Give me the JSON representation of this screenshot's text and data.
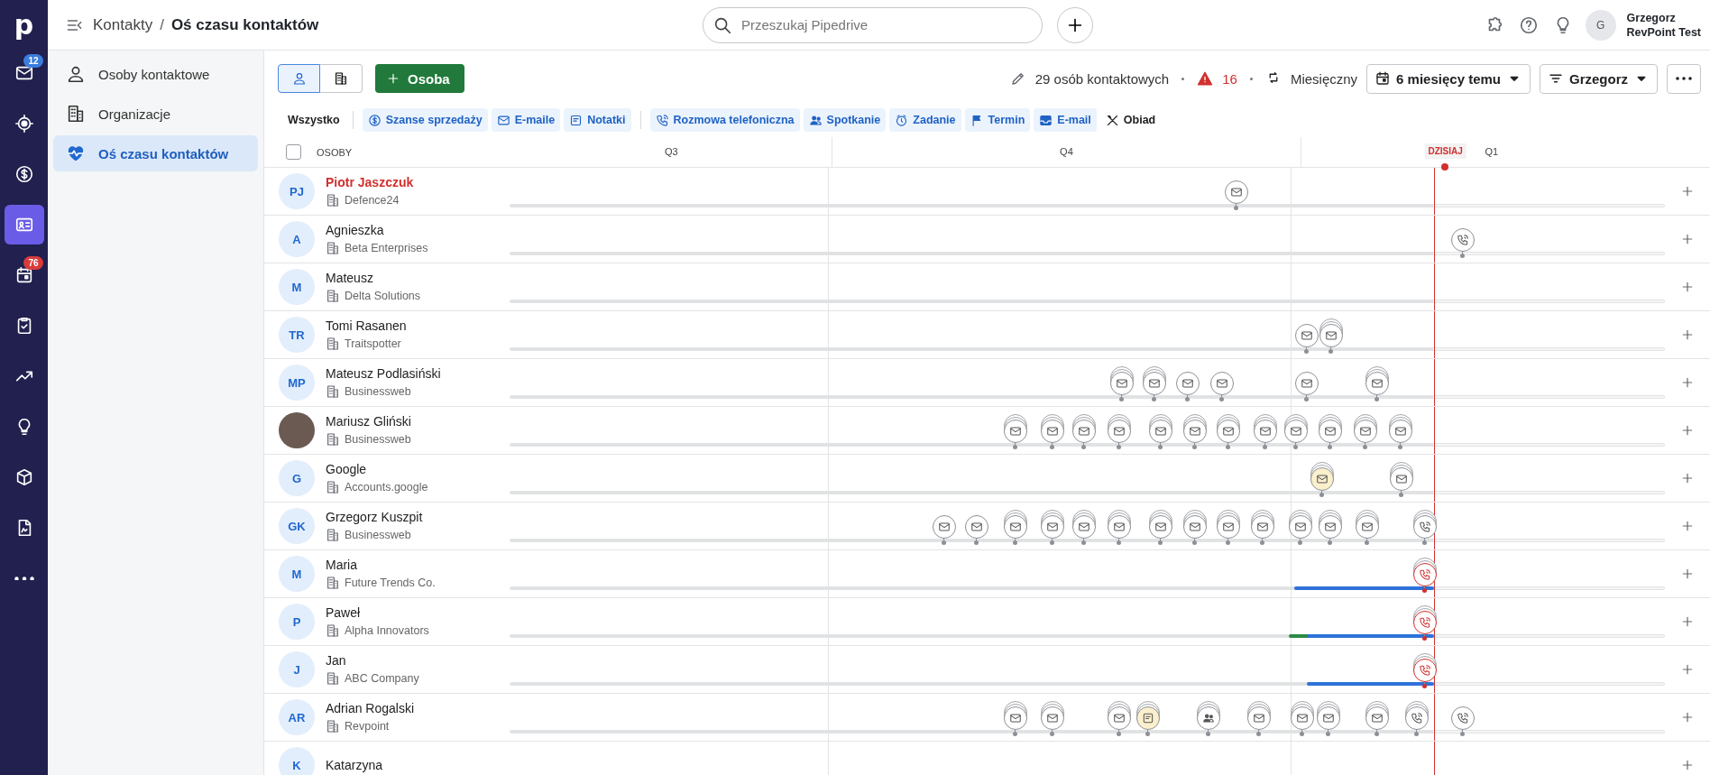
{
  "logo": "p",
  "rail": [
    {
      "kind": "mail",
      "badge": "12",
      "color": "#3b7ddd",
      "selected": false
    },
    {
      "kind": "target",
      "selected": false
    },
    {
      "kind": "deals",
      "selected": false
    },
    {
      "kind": "contacts",
      "selected": true
    },
    {
      "kind": "calendar",
      "badge": "76",
      "color": "#d93b3b",
      "selected": false
    },
    {
      "kind": "tasks",
      "selected": false
    },
    {
      "kind": "insights",
      "selected": false
    },
    {
      "kind": "campaigns",
      "selected": false
    },
    {
      "kind": "products",
      "selected": false
    },
    {
      "kind": "documents",
      "selected": false
    },
    {
      "kind": "more",
      "selected": false
    }
  ],
  "breadcrumb": {
    "parent": "Kontakty",
    "separator": "/",
    "current": "Oś czasu kontaktów"
  },
  "search": {
    "placeholder": "Przeszukaj Pipedrive"
  },
  "user": {
    "initial": "G",
    "name": "Grzegorz",
    "company": "RevPoint Test"
  },
  "sidebar": [
    {
      "kind": "person",
      "label": "Osoby kontaktowe",
      "selected": false
    },
    {
      "kind": "org",
      "label": "Organizacje",
      "selected": false
    },
    {
      "kind": "timeline",
      "label": "Oś czasu kontaktów",
      "selected": true
    }
  ],
  "view_toggle": [
    {
      "kind": "person",
      "selected": true
    },
    {
      "kind": "org",
      "selected": false
    }
  ],
  "add_button": {
    "label": "Osoba"
  },
  "summary": {
    "count": "29 osób kontaktowych",
    "alerts": "16",
    "interval": "Miesięczny"
  },
  "period_dropdown": {
    "label": "6 miesięcy temu"
  },
  "owner_filter": {
    "label": "Grzegorz"
  },
  "filters": [
    {
      "kind": "all",
      "label": "Wszystko",
      "selected": false
    },
    {
      "kind": "deal",
      "label": "Szanse sprzedaży",
      "selected": true
    },
    {
      "kind": "email",
      "label": "E-maile",
      "selected": true
    },
    {
      "kind": "note",
      "label": "Notatki",
      "selected": true
    },
    {
      "kind": "call",
      "label": "Rozmowa telefoniczna",
      "selected": true
    },
    {
      "kind": "meeting",
      "label": "Spotkanie",
      "selected": true
    },
    {
      "kind": "task",
      "label": "Zadanie",
      "selected": true
    },
    {
      "kind": "deadline",
      "label": "Termin",
      "selected": true
    },
    {
      "kind": "inbox",
      "label": "E-mail",
      "selected": true
    },
    {
      "kind": "lunch",
      "label": "Obiad",
      "selected": false
    }
  ],
  "header": {
    "select_all": false,
    "column": "OSOBY",
    "quarters": [
      "Q3",
      "Q4",
      "Q1"
    ],
    "today": "DZISIAJ"
  },
  "rows": [
    {
      "initials": "PJ",
      "photo": false,
      "name": "Piotr Jaszczuk",
      "name_alert": true,
      "company": "Defence24",
      "events": [
        {
          "kind": "email",
          "stacked": false,
          "highlighted": false,
          "overdue": false
        }
      ]
    },
    {
      "initials": "A",
      "photo": false,
      "name": "Agnieszka",
      "name_alert": false,
      "company": "Beta Enterprises",
      "events": [
        {
          "kind": "call",
          "stacked": false,
          "highlighted": false,
          "overdue": false
        }
      ]
    },
    {
      "initials": "M",
      "photo": false,
      "name": "Mateusz",
      "name_alert": false,
      "company": "Delta Solutions",
      "events": []
    },
    {
      "initials": "TR",
      "photo": false,
      "name": "Tomi Rasanen",
      "name_alert": false,
      "company": "Traitspotter",
      "events": [
        {
          "kind": "email",
          "stacked": false,
          "highlighted": false,
          "overdue": false
        },
        {
          "kind": "email",
          "stacked": true,
          "highlighted": false,
          "overdue": false
        }
      ]
    },
    {
      "initials": "MP",
      "photo": false,
      "name": "Mateusz Podlasiński",
      "name_alert": false,
      "company": "Businessweb",
      "events": [
        {
          "kind": "email",
          "stacked": true,
          "highlighted": false,
          "overdue": false
        },
        {
          "kind": "email",
          "stacked": true,
          "highlighted": false,
          "overdue": false
        },
        {
          "kind": "email",
          "stacked": false,
          "highlighted": false,
          "overdue": false
        },
        {
          "kind": "email",
          "stacked": false,
          "highlighted": false,
          "overdue": false
        },
        {
          "kind": "email",
          "stacked": false,
          "highlighted": false,
          "overdue": false
        },
        {
          "kind": "email",
          "stacked": true,
          "highlighted": false,
          "overdue": false
        }
      ]
    },
    {
      "photo": true,
      "name": "Mariusz Gliński",
      "name_alert": false,
      "company": "Businessweb",
      "events": [
        {
          "kind": "email",
          "stacked": true,
          "highlighted": false,
          "overdue": false
        },
        {
          "kind": "email",
          "stacked": true,
          "highlighted": false,
          "overdue": false
        },
        {
          "kind": "email",
          "stacked": true,
          "highlighted": false,
          "overdue": false
        },
        {
          "kind": "email",
          "stacked": true,
          "highlighted": false,
          "overdue": false
        },
        {
          "kind": "email",
          "stacked": true,
          "highlighted": false,
          "overdue": false
        },
        {
          "kind": "email",
          "stacked": true,
          "highlighted": false,
          "overdue": false
        },
        {
          "kind": "email",
          "stacked": true,
          "highlighted": false,
          "overdue": false
        },
        {
          "kind": "email",
          "stacked": true,
          "highlighted": false,
          "overdue": false
        },
        {
          "kind": "email",
          "stacked": true,
          "highlighted": false,
          "overdue": false
        },
        {
          "kind": "email",
          "stacked": true,
          "highlighted": false,
          "overdue": false
        },
        {
          "kind": "email",
          "stacked": true,
          "highlighted": false,
          "overdue": false
        },
        {
          "kind": "email",
          "stacked": true,
          "highlighted": false,
          "overdue": false
        }
      ]
    },
    {
      "initials": "G",
      "photo": false,
      "name": "Google",
      "name_alert": false,
      "company": "Accounts.google",
      "events": [
        {
          "kind": "email",
          "stacked": true,
          "highlighted": true,
          "overdue": false
        },
        {
          "kind": "email",
          "stacked": true,
          "highlighted": false,
          "overdue": false
        }
      ]
    },
    {
      "initials": "GK",
      "photo": false,
      "name": "Grzegorz Kuszpit",
      "name_alert": false,
      "company": "Businessweb",
      "events": [
        {
          "kind": "email",
          "stacked": false,
          "highlighted": false,
          "overdue": false
        },
        {
          "kind": "email",
          "stacked": false,
          "highlighted": false,
          "overdue": false
        },
        {
          "kind": "email",
          "stacked": true,
          "highlighted": false,
          "overdue": false
        },
        {
          "kind": "email",
          "stacked": true,
          "highlighted": false,
          "overdue": false
        },
        {
          "kind": "email",
          "stacked": true,
          "highlighted": false,
          "overdue": false
        },
        {
          "kind": "email",
          "stacked": true,
          "highlighted": false,
          "overdue": false
        },
        {
          "kind": "email",
          "stacked": true,
          "highlighted": false,
          "overdue": false
        },
        {
          "kind": "email",
          "stacked": true,
          "highlighted": false,
          "overdue": false
        },
        {
          "kind": "email",
          "stacked": true,
          "highlighted": false,
          "overdue": false
        },
        {
          "kind": "email",
          "stacked": true,
          "highlighted": false,
          "overdue": false
        },
        {
          "kind": "email",
          "stacked": true,
          "highlighted": false,
          "overdue": false
        },
        {
          "kind": "email",
          "stacked": true,
          "highlighted": false,
          "overdue": false
        },
        {
          "kind": "email",
          "stacked": true,
          "highlighted": false,
          "overdue": false
        },
        {
          "kind": "call",
          "stacked": true,
          "highlighted": false,
          "overdue": false
        }
      ]
    },
    {
      "initials": "M",
      "photo": false,
      "name": "Maria",
      "name_alert": false,
      "company": "Future Trends Co.",
      "events": [
        {
          "kind": "call",
          "stacked": true,
          "highlighted": false,
          "overdue": true
        }
      ]
    },
    {
      "initials": "P",
      "photo": false,
      "name": "Paweł",
      "name_alert": false,
      "company": "Alpha Innovators",
      "events": [
        {
          "kind": "call",
          "stacked": true,
          "highlighted": false,
          "overdue": true
        }
      ]
    },
    {
      "initials": "J",
      "photo": false,
      "name": "Jan",
      "name_alert": false,
      "company": "ABC Company",
      "events": [
        {
          "kind": "call",
          "stacked": true,
          "highlighted": false,
          "overdue": true
        }
      ]
    },
    {
      "initials": "AR",
      "photo": false,
      "name": "Adrian Rogalski",
      "name_alert": false,
      "company": "Revpoint",
      "events": [
        {
          "kind": "email",
          "stacked": true,
          "highlighted": false,
          "overdue": false
        },
        {
          "kind": "email",
          "stacked": true,
          "highlighted": false,
          "overdue": false
        },
        {
          "kind": "email",
          "stacked": true,
          "highlighted": false,
          "overdue": false
        },
        {
          "kind": "note",
          "stacked": true,
          "highlighted": true,
          "overdue": false
        },
        {
          "kind": "meeting",
          "stacked": true,
          "highlighted": false,
          "overdue": false
        },
        {
          "kind": "email",
          "stacked": true,
          "highlighted": false,
          "overdue": false
        },
        {
          "kind": "email",
          "stacked": true,
          "highlighted": false,
          "overdue": false
        },
        {
          "kind": "email",
          "stacked": true,
          "highlighted": false,
          "overdue": false
        },
        {
          "kind": "email",
          "stacked": true,
          "highlighted": false,
          "overdue": false
        },
        {
          "kind": "call",
          "stacked": true,
          "highlighted": false,
          "overdue": false
        },
        {
          "kind": "call",
          "stacked": false,
          "highlighted": false,
          "overdue": false
        }
      ]
    },
    {
      "initials": "K",
      "photo": false,
      "name": "Katarzyna",
      "name_alert": false,
      "events": []
    }
  ]
}
